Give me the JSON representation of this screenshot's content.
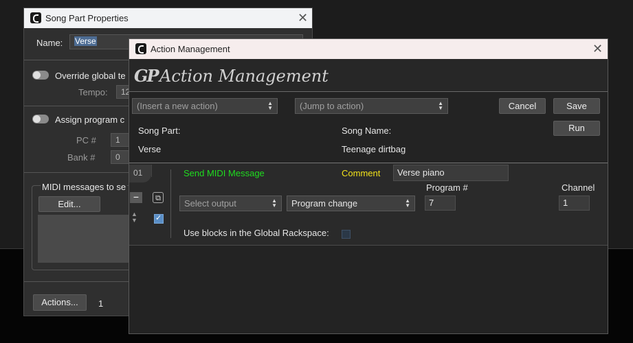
{
  "song_part_window": {
    "title": "Song Part Properties",
    "close": "✕",
    "name_label": "Name:",
    "name_value": "Verse",
    "override_label": "Override global te",
    "tempo_label": "Tempo:",
    "tempo_value": "12",
    "assign_label": "Assign program c",
    "pc_label": "PC #",
    "pc_value": "1",
    "bank_label": "Bank #",
    "bank_value": "0",
    "midi_label": "MIDI messages to se",
    "edit_button": "Edit...",
    "actions_button": "Actions...",
    "actions_count": "1"
  },
  "action_window": {
    "title": "Action Management",
    "close": "✕",
    "logo_mark": "GP",
    "banner_title": "Action Management",
    "insert_dropdown": "(Insert a new action)",
    "jump_dropdown": "(Jump to action)",
    "cancel_button": "Cancel",
    "save_button": "Save",
    "run_button": "Run",
    "song_part_label": "Song Part:",
    "song_part_value": "Verse",
    "song_name_label": "Song Name:",
    "song_name_value": "Teenage dirtbag",
    "action": {
      "index": "01",
      "type": "Send MIDI Message",
      "comment_label": "Comment",
      "comment_value": "Verse piano",
      "output_select": "Select output",
      "message_type_select": "Program change",
      "program_label": "Program #",
      "program_value": "7",
      "channel_label": "Channel",
      "channel_value": "1",
      "global_blocks_label": "Use blocks in the Global Rackspace:",
      "enabled_checked": true,
      "global_blocks_checked": false
    }
  }
}
